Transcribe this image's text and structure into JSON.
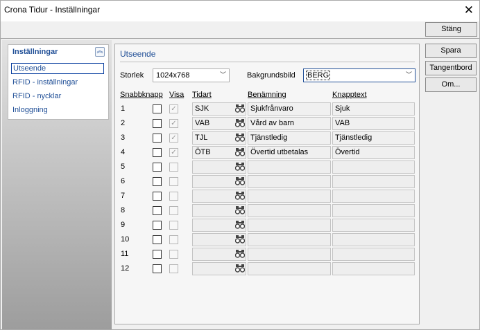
{
  "window": {
    "title": "Crona Tidur - Inställningar"
  },
  "toolbar": {
    "close_label": "Stäng"
  },
  "side_buttons": {
    "save_label": "Spara",
    "keyboard_label": "Tangentbord",
    "about_label": "Om..."
  },
  "sidebar": {
    "title": "Inställningar",
    "items": [
      {
        "label": "Utseende",
        "selected": true
      },
      {
        "label": "RFID - inställningar",
        "selected": false
      },
      {
        "label": "RFID - nycklar",
        "selected": false
      },
      {
        "label": "Inloggning",
        "selected": false
      }
    ]
  },
  "main": {
    "section_title": "Utseende",
    "size_label": "Storlek",
    "size_value": "1024x768",
    "background_label": "Bakgrundsbild",
    "background_value": "BERG",
    "columns": {
      "quick": "Snabbknapp",
      "show": "Visa",
      "timetype": "Tidart",
      "name": "Benämning",
      "buttontext": "Knapptext"
    },
    "rows": [
      {
        "num": "1",
        "code": "SJK",
        "name": "Sjukfrånvaro",
        "text": "Sjuk",
        "visa": true
      },
      {
        "num": "2",
        "code": "VAB",
        "name": "Vård av barn",
        "text": "VAB",
        "visa": true
      },
      {
        "num": "3",
        "code": "TJL",
        "name": "Tjänstledig",
        "text": "Tjänstledig",
        "visa": true
      },
      {
        "num": "4",
        "code": "ÖTB",
        "name": "Övertid utbetalas",
        "text": "Övertid",
        "visa": true
      },
      {
        "num": "5",
        "code": "",
        "name": "",
        "text": "",
        "visa": false
      },
      {
        "num": "6",
        "code": "",
        "name": "",
        "text": "",
        "visa": false
      },
      {
        "num": "7",
        "code": "",
        "name": "",
        "text": "",
        "visa": false
      },
      {
        "num": "8",
        "code": "",
        "name": "",
        "text": "",
        "visa": false
      },
      {
        "num": "9",
        "code": "",
        "name": "",
        "text": "",
        "visa": false
      },
      {
        "num": "10",
        "code": "",
        "name": "",
        "text": "",
        "visa": false
      },
      {
        "num": "11",
        "code": "",
        "name": "",
        "text": "",
        "visa": false
      },
      {
        "num": "12",
        "code": "",
        "name": "",
        "text": "",
        "visa": false
      }
    ]
  }
}
